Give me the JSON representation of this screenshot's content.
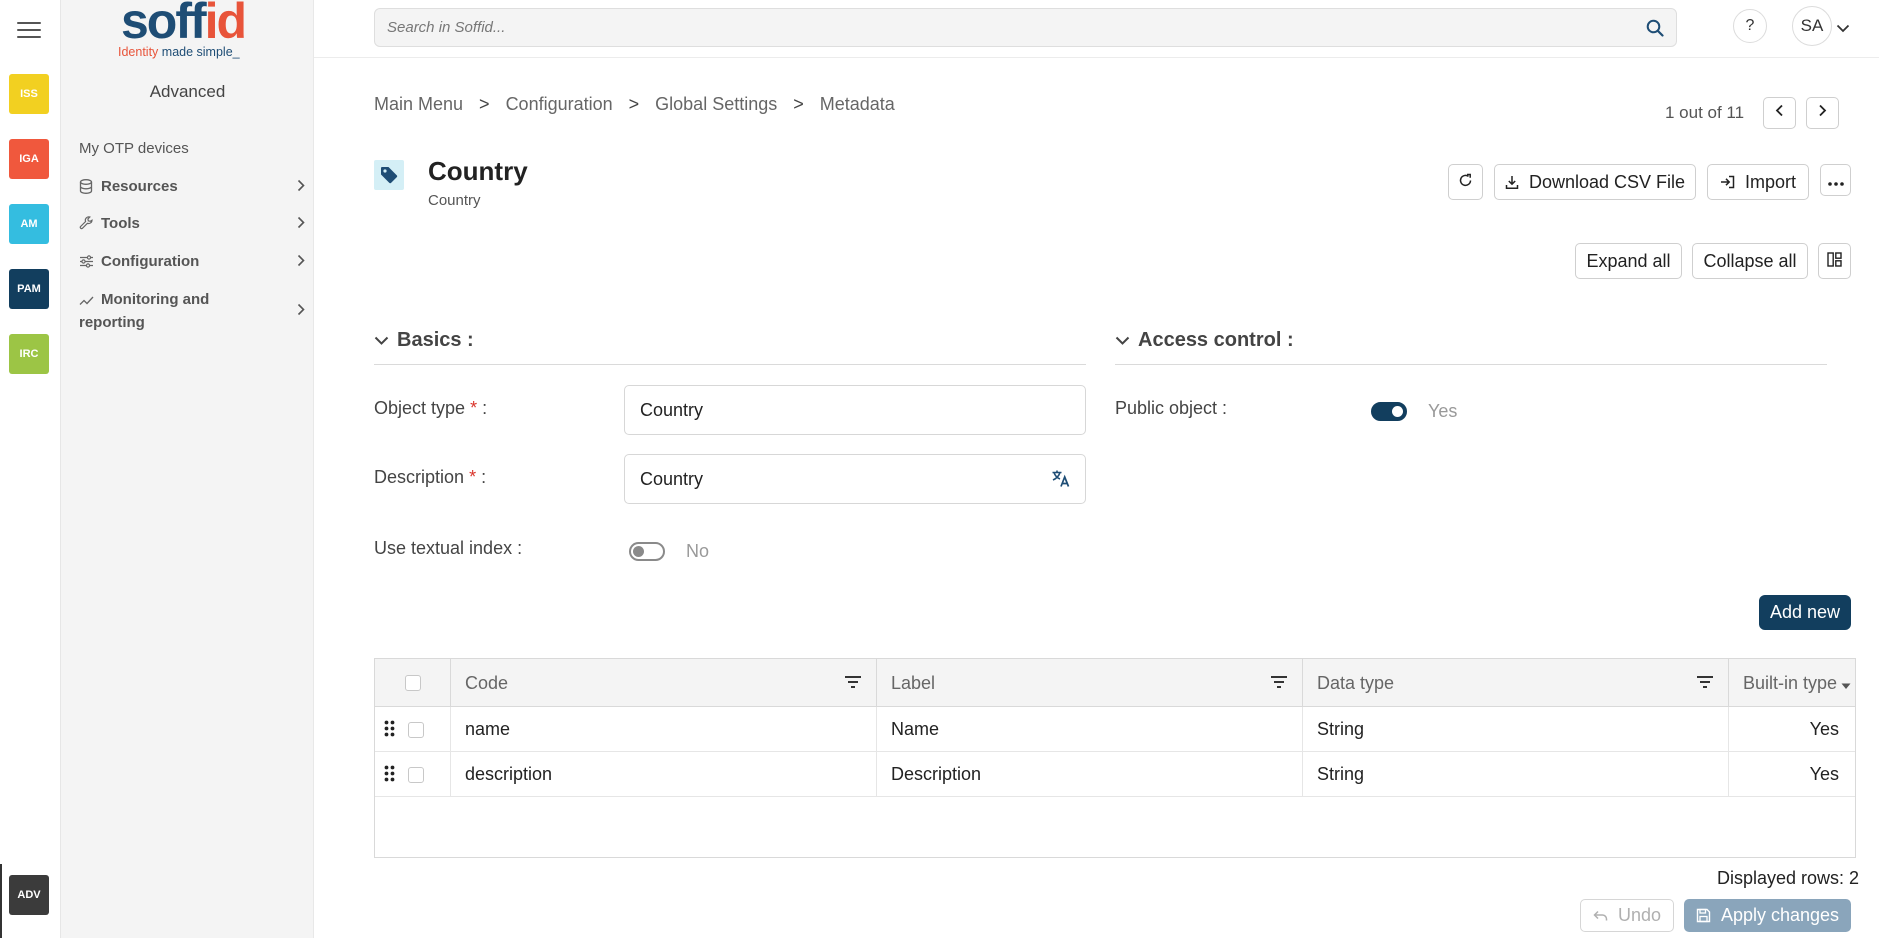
{
  "apps": [
    {
      "label": "ISS",
      "color": "#f2d021"
    },
    {
      "label": "IGA",
      "color": "#f0583d"
    },
    {
      "label": "AM",
      "color": "#34bde0"
    },
    {
      "label": "PAM",
      "color": "#123e5e"
    },
    {
      "label": "IRC",
      "color": "#9cc545"
    }
  ],
  "adv_app": {
    "label": "ADV"
  },
  "logo": {
    "word_main": "soff",
    "word_accent": "id",
    "tag_main": "Identity ",
    "tag_dark": "made simple_"
  },
  "sidebar": {
    "title": "Advanced",
    "otp": "My OTP devices",
    "items": [
      {
        "label": "Resources"
      },
      {
        "label": "Tools"
      },
      {
        "label": "Configuration"
      },
      {
        "label": "Monitoring and reporting"
      }
    ]
  },
  "topbar": {
    "search_placeholder": "Search in Soffid...",
    "help": "?",
    "avatar": "SA"
  },
  "breadcrumb": [
    "Main Menu",
    "Configuration",
    "Global Settings",
    "Metadata"
  ],
  "breadcrumb_sep": ">",
  "pager": {
    "text": "1 out of 11"
  },
  "header": {
    "title": "Country",
    "subtitle": "Country",
    "download": "Download CSV File",
    "import": "Import"
  },
  "view": {
    "expand": "Expand all",
    "collapse": "Collapse all"
  },
  "basics": {
    "title": "Basics :",
    "object_type_label": "Object type",
    "object_type_value": "Country",
    "description_label": "Description",
    "description_value": "Country",
    "required_mark": "*",
    "colon": " :",
    "textual_index_label": "Use textual index :",
    "textual_index_value": "No"
  },
  "access": {
    "title": "Access control :",
    "public_label": "Public object :",
    "public_value": "Yes"
  },
  "table": {
    "add_new": "Add new",
    "columns": [
      "Code",
      "Label",
      "Data type",
      "Built-in type"
    ],
    "rows": [
      {
        "code": "name",
        "label": "Name",
        "type": "String",
        "builtin": "Yes"
      },
      {
        "code": "description",
        "label": "Description",
        "type": "String",
        "builtin": "Yes"
      }
    ],
    "rows_count": "Displayed rows: 2"
  },
  "footer": {
    "undo": "Undo",
    "apply": "Apply changes"
  },
  "colors": {
    "brand_dark": "#123e5e",
    "brand_orange": "#e8543a",
    "required": "#d9342b"
  }
}
